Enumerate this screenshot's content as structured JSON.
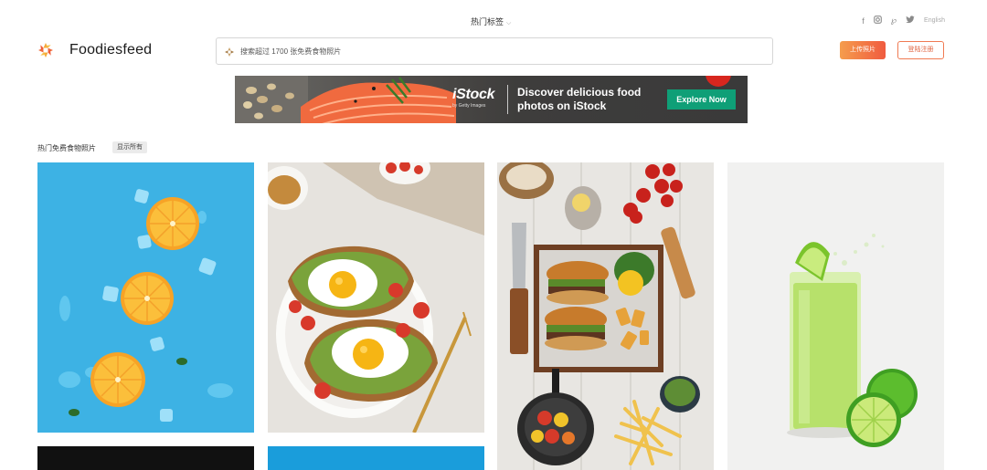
{
  "nav": {
    "tags_label": "热门标签",
    "social_icons": [
      "facebook-icon",
      "instagram-icon",
      "pinterest-icon",
      "twitter-icon"
    ],
    "language_label": "English"
  },
  "header": {
    "brand": "Foodiesfeed",
    "search_placeholder": "搜索超过 1700 张免费食物照片",
    "upload_label": "上传照片",
    "login_label": "登陆注册"
  },
  "ad": {
    "brand": "iStock",
    "brand_sub": "by Getty Images",
    "text": "Discover delicious food photos on iStock",
    "cta": "Explore Now",
    "cta_color": "#0f9f77"
  },
  "section": {
    "title": "热门免费食物照片",
    "show_all": "显示所有"
  },
  "colors": {
    "accent": "#f05b3f",
    "tile1_bg": "#3fb3e5",
    "tile4_bg": "#f2f2f2"
  },
  "photos": [
    {
      "subject": "orange slices on blue"
    },
    {
      "subject": "avocado toast with fried eggs"
    },
    {
      "subject": "burgers and fries tray"
    },
    {
      "subject": "lime juice glass"
    }
  ]
}
